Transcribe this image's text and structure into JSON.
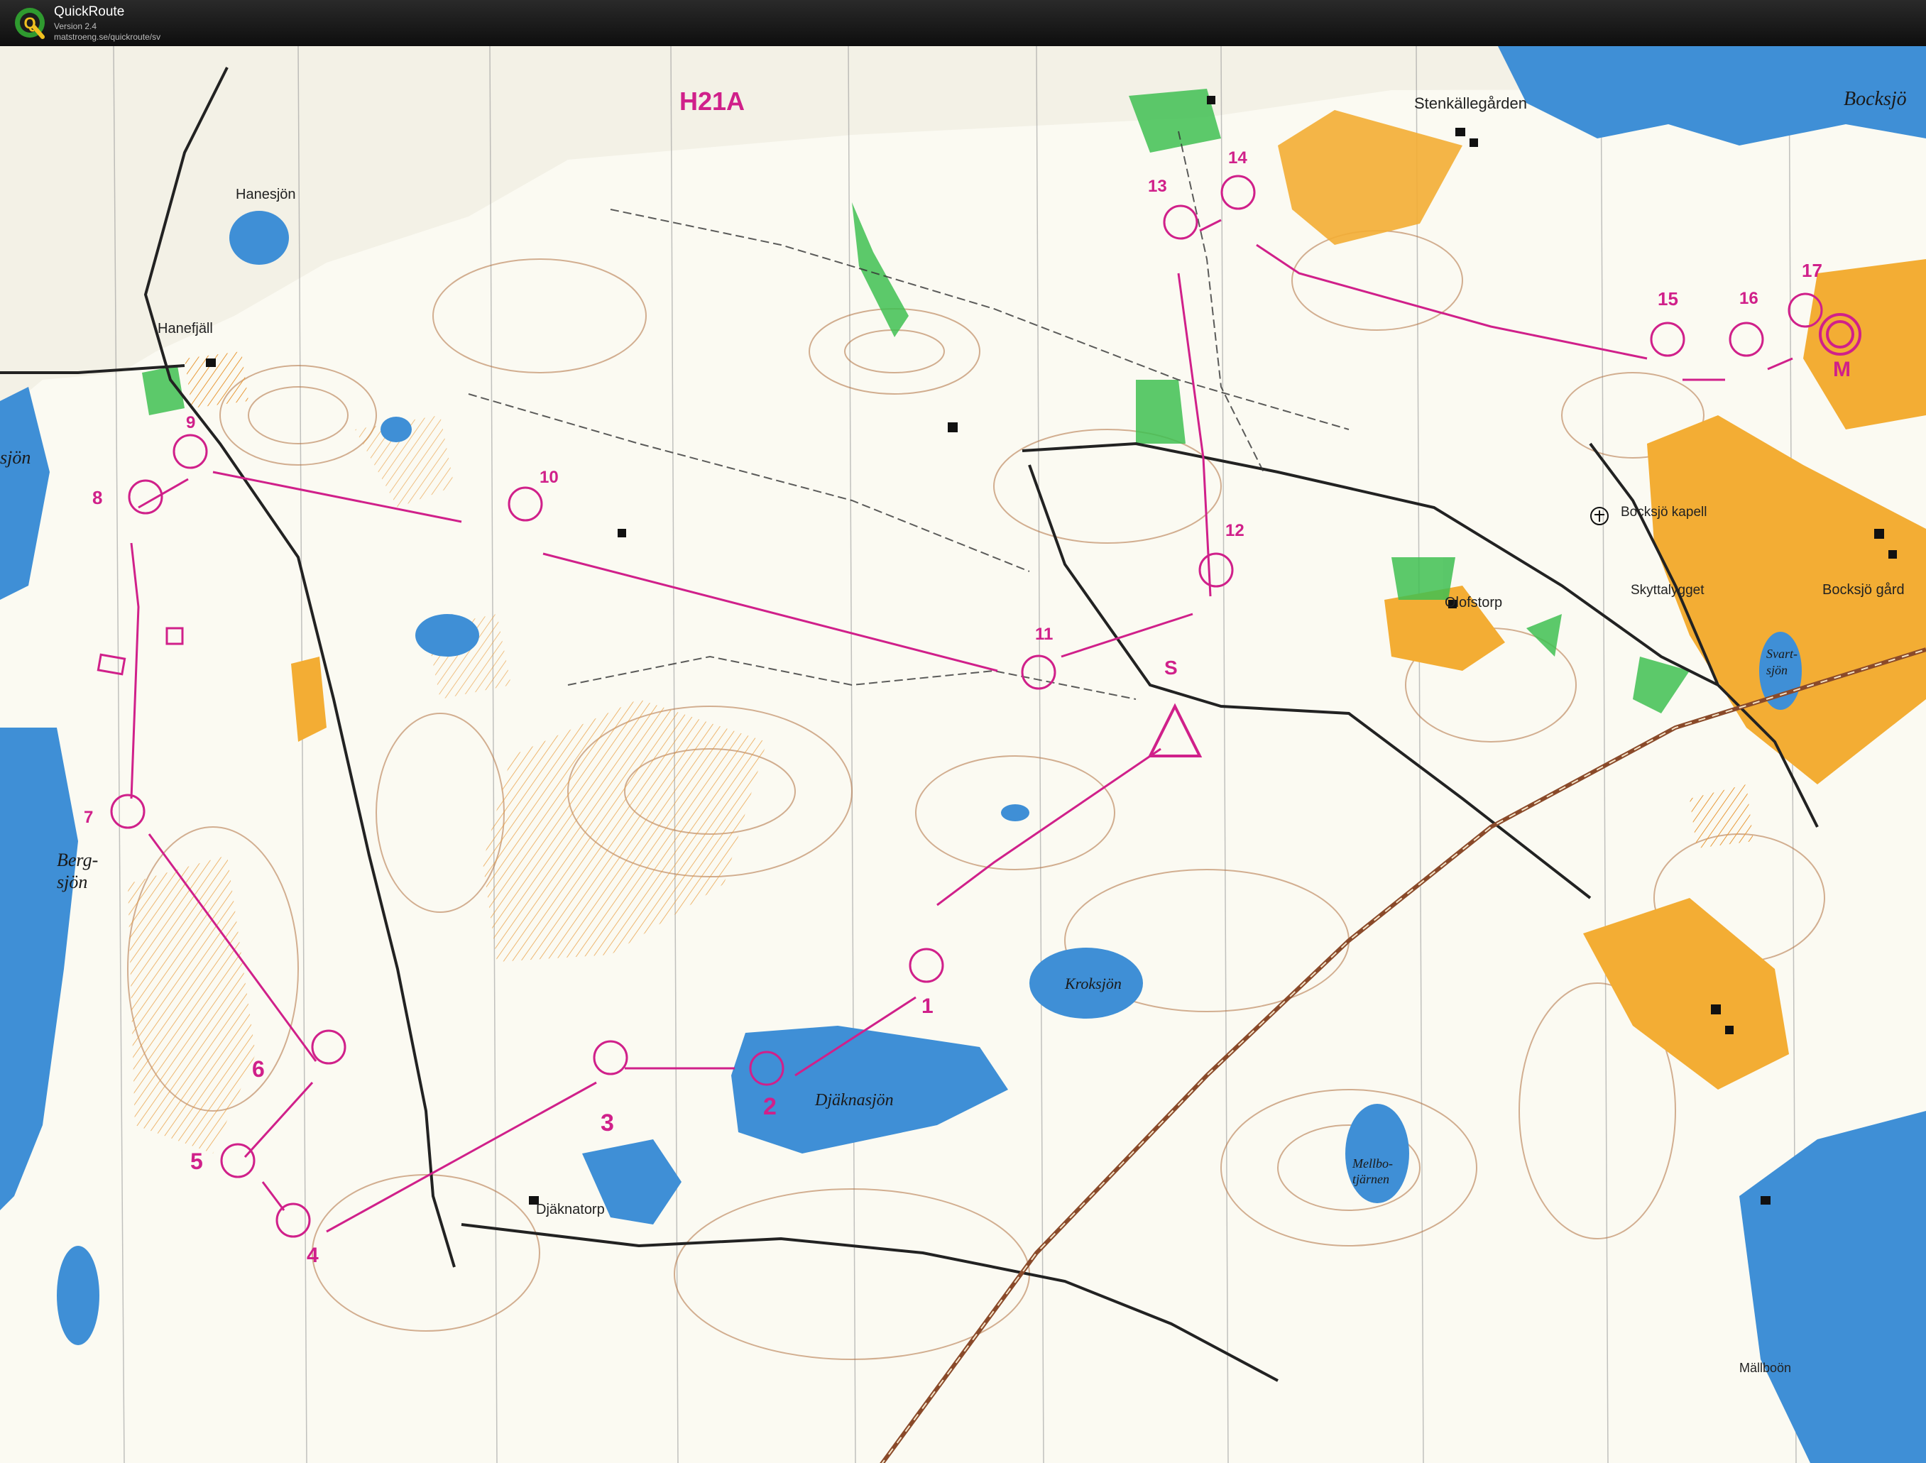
{
  "app": {
    "name": "QuickRoute",
    "version": "Version 2.4",
    "url": "matstroeng.se/quickroute/sv",
    "logo_letter": "Q"
  },
  "map": {
    "course_label": "H21A",
    "colors": {
      "paper": "#fbfaf2",
      "water": "#3f8fd6",
      "field_yellow": "#f3ad34",
      "green": "#3fbf52",
      "contour": "#a8653a",
      "course": "#d0208a",
      "road": "#222222",
      "rail": "#8a4a2a"
    },
    "place_names": {
      "hanesjon": "Hanesjön",
      "hanefjall": "Hanefjäll",
      "stenkallegarden": "Stenkällegården",
      "bocksjon": "Bocksjö",
      "bocksjo_kapell": "Bocksjö kapell",
      "skyttalygget": "Skyttalygget",
      "bocksjo_gard": "Bocksjö gård",
      "olofstorp": "Olofstorp",
      "svartsjon_1": "Svart-",
      "svartsjon_2": "sjön",
      "bergsjon_1": "Berg-",
      "bergsjon_2": "sjön",
      "sjon_left": "sjön",
      "kroksjon": "Kroksjön",
      "djaknasjon": "Djäknasjön",
      "djaknatorp": "Djäknatorp",
      "mellbotjarnen_1": "Mellbo-",
      "mellbotjarnen_2": "tjärnen",
      "mallboon": "Mällboön"
    },
    "start_label": "S",
    "finish_label": "M",
    "controls": [
      {
        "n": "1"
      },
      {
        "n": "2"
      },
      {
        "n": "3"
      },
      {
        "n": "4"
      },
      {
        "n": "5"
      },
      {
        "n": "6"
      },
      {
        "n": "7"
      },
      {
        "n": "8"
      },
      {
        "n": "9"
      },
      {
        "n": "10"
      },
      {
        "n": "11"
      },
      {
        "n": "12"
      },
      {
        "n": "13"
      },
      {
        "n": "14"
      },
      {
        "n": "15"
      },
      {
        "n": "16"
      },
      {
        "n": "17"
      }
    ]
  }
}
